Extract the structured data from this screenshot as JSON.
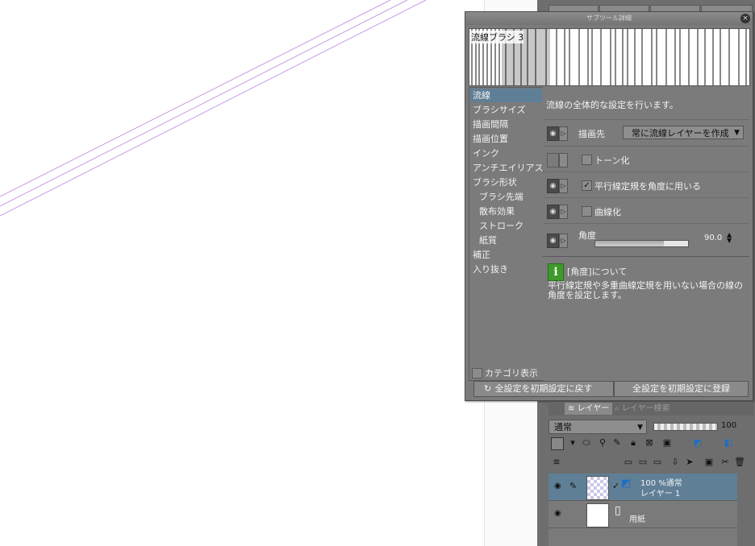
{
  "dialog": {
    "title": "サブツール詳細",
    "close": "×",
    "preview_label": "流線ブラシ 3",
    "categories": [
      "流線",
      "ブラシサイズ",
      "描画間隔",
      "描画位置",
      "インク",
      "アンチエイリアス",
      "ブラシ形状",
      "ブラシ先端",
      "散布効果",
      "ストローク",
      "紙質",
      "補正",
      "入り抜き"
    ],
    "selected_category": "流線",
    "category_display_label": "カテゴリ表示",
    "description": "流線の全体的な設定を行います。",
    "rows": {
      "draw_to": {
        "label": "描画先",
        "value": "常に流線レイヤーを作成"
      },
      "tone": {
        "label": "トーン化",
        "checked": false
      },
      "parallel": {
        "label": "平行線定規を角度に用いる",
        "checked": true
      },
      "curve": {
        "label": "曲線化",
        "checked": false
      },
      "angle": {
        "label": "角度",
        "value": "90.0",
        "fill_fraction": 0.74
      }
    },
    "info": {
      "icon": "info-icon",
      "icon_glyph": "i",
      "title": "[角度]について",
      "text": "平行線定規や多重曲線定規を用いない場合の線の角度を設定します。"
    },
    "buttons": {
      "reset": "全設定を初期設定に戻す",
      "register": "全設定を初期設定に登録"
    }
  },
  "layer_panel": {
    "tabs": [
      "レイヤー",
      "レイヤー検索"
    ],
    "blend_mode": "通常",
    "opacity": "100",
    "layers": [
      {
        "line1": "100 %通常",
        "line2": "レイヤー 1",
        "selected": true
      },
      {
        "line1": "用紙",
        "selected": false
      }
    ]
  },
  "colors": {
    "panel": "#7b7b7b",
    "selection": "#5f7f96",
    "info_green": "#3e9a2a",
    "guide_line": "#b07ad8"
  }
}
